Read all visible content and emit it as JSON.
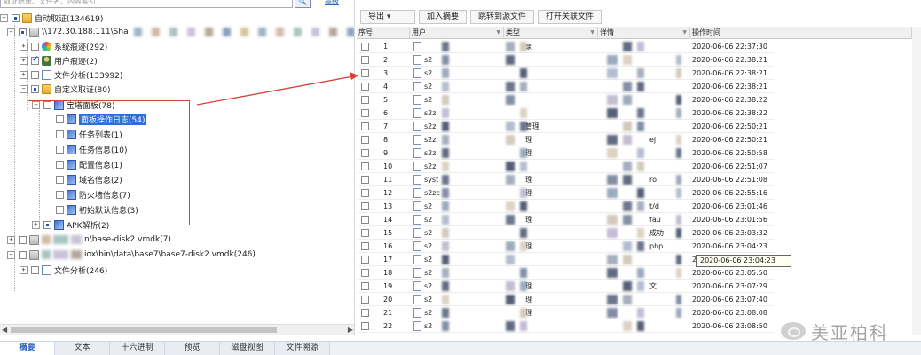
{
  "search": {
    "placeholder": "取证结果、文件名、内容索引",
    "button": "🔍",
    "advanced": "高级"
  },
  "tree": [
    {
      "id": "root",
      "expander": "−",
      "check": "partial",
      "icon": "folder",
      "label": "自动取证(134619)"
    },
    {
      "id": "share",
      "expander": "−",
      "check": "partial",
      "icon": "drive",
      "label": "\\\\172.30.188.111\\Sha",
      "blurred": true
    },
    {
      "id": "sys",
      "expander": "+",
      "check": "none",
      "icon": "colour",
      "label": "系统痕迹(292)"
    },
    {
      "id": "user",
      "expander": "+",
      "check": "checked",
      "icon": "user",
      "label": "用户痕迹(2)"
    },
    {
      "id": "fileana",
      "expander": "+",
      "check": "none",
      "icon": "doc",
      "label": "文件分析(133992)"
    },
    {
      "id": "custom",
      "expander": "−",
      "check": "partial",
      "icon": "folder",
      "label": "自定义取证(80)"
    },
    {
      "id": "baota",
      "expander": "−",
      "check": "none",
      "icon": "tool",
      "label": "宝塔面板(78)"
    },
    {
      "id": "panel-log",
      "expander": "",
      "check": "none",
      "icon": "tool",
      "label": "面板操作日志(54)",
      "selected": true
    },
    {
      "id": "task-list",
      "expander": "",
      "check": "none",
      "icon": "tool",
      "label": "任务列表(1)"
    },
    {
      "id": "task-info",
      "expander": "",
      "check": "none",
      "icon": "tool",
      "label": "任务信息(10)"
    },
    {
      "id": "config",
      "expander": "",
      "check": "none",
      "icon": "tool",
      "label": "配置信息(1)"
    },
    {
      "id": "domain",
      "expander": "",
      "check": "none",
      "icon": "tool",
      "label": "域名信息(2)"
    },
    {
      "id": "firewall",
      "expander": "",
      "check": "none",
      "icon": "tool",
      "label": "防火墙信息(7)"
    },
    {
      "id": "default",
      "expander": "",
      "check": "none",
      "icon": "tool",
      "label": "初始默认信息(3)"
    },
    {
      "id": "apk",
      "expander": "+",
      "check": "partial",
      "icon": "tool",
      "label": "APK解析(2)"
    },
    {
      "id": "disk2",
      "expander": "+",
      "check": "none",
      "icon": "drive",
      "label": "n\\base-disk2.vmdk(7)",
      "blurred": true
    },
    {
      "id": "disk7",
      "expander": "−",
      "check": "none",
      "icon": "drive",
      "label": "iox\\bin\\data\\base7\\base7-disk2.vmdk(246)",
      "blurred": true
    },
    {
      "id": "fileana2",
      "expander": "+",
      "check": "none",
      "icon": "doc",
      "label": "文件分析(246)"
    }
  ],
  "toolbar": {
    "export": "导出",
    "add_summary": "加入摘要",
    "jump_source": "跳转到源文件",
    "open_related": "打开关联文件"
  },
  "table": {
    "columns": [
      "序号",
      "用户",
      "类型",
      "详情",
      "操作时间"
    ],
    "rows": [
      {
        "no": "1",
        "user": "",
        "type": "录",
        "detail": "",
        "time": "2020-06-06 22:37:30"
      },
      {
        "no": "2",
        "user": "s2",
        "type": "",
        "detail": "",
        "time": "2020-06-06 22:38:21"
      },
      {
        "no": "3",
        "user": "s2",
        "type": "",
        "detail": "",
        "time": "2020-06-06 22:38:21"
      },
      {
        "no": "4",
        "user": "s2",
        "type": "",
        "detail": "",
        "time": "2020-06-06 22:38:21"
      },
      {
        "no": "5",
        "user": "s2",
        "type": "",
        "detail": "",
        "time": "2020-06-06 22:38:22"
      },
      {
        "no": "6",
        "user": "s2z",
        "type": "",
        "detail": "",
        "time": "2020-06-06 22:38:22"
      },
      {
        "no": "7",
        "user": "s2z",
        "type": "管理",
        "detail": "",
        "time": "2020-06-06 22:50:21"
      },
      {
        "no": "8",
        "user": "s2z",
        "type": "理",
        "detail": "ej",
        "time": "2020-06-06 22:50:21"
      },
      {
        "no": "9",
        "user": "s2z",
        "type": "理",
        "detail": "",
        "time": "2020-06-06 22:50:58"
      },
      {
        "no": "10",
        "user": "s2z",
        "type": "",
        "detail": "",
        "time": "2020-06-06 22:51:07"
      },
      {
        "no": "11",
        "user": "syst",
        "type": "理",
        "detail": "ro",
        "time": "2020-06-06 22:51:08"
      },
      {
        "no": "12",
        "user": "s2zc",
        "type": "理",
        "detail": "",
        "time": "2020-06-06 22:55:16"
      },
      {
        "no": "13",
        "user": "s2",
        "type": "",
        "detail": "t/d",
        "time": "2020-06-06 23:01:46"
      },
      {
        "no": "14",
        "user": "s2",
        "type": "理",
        "detail": "fau",
        "time": "2020-06-06 23:01:56"
      },
      {
        "no": "15",
        "user": "s2",
        "type": "",
        "detail": "成功",
        "time": "2020-06-06 23:03:32"
      },
      {
        "no": "16",
        "user": "s2",
        "type": "理",
        "detail": "php",
        "time": "2020-06-06 23:04:23"
      },
      {
        "no": "17",
        "user": "s2",
        "type": "",
        "detail": "",
        "time": "2020-06-06 23:04:23"
      },
      {
        "no": "18",
        "user": "s2",
        "type": "",
        "detail": "",
        "time": "2020-06-06 23:05:50"
      },
      {
        "no": "19",
        "user": "s2",
        "type": "理",
        "detail": "文",
        "time": "2020-06-06 23:07:29"
      },
      {
        "no": "20",
        "user": "s2",
        "type": "理",
        "detail": "",
        "time": "2020-06-06 23:07:40"
      },
      {
        "no": "21",
        "user": "s2",
        "type": "理",
        "detail": "",
        "time": "2020-06-06 23:08:08"
      },
      {
        "no": "22",
        "user": "s2",
        "type": "",
        "detail": "",
        "time": "2020-06-06 23:08:50"
      }
    ],
    "tooltip": "2020-06-06 23:04:23"
  },
  "bottom_tabs": [
    "摘要",
    "文本",
    "十六进制",
    "预览",
    "磁盘视图",
    "文件溯源"
  ],
  "watermark": "美亚柏科",
  "colors": {
    "accent": "#2a6fdb",
    "callout": "#d9403a"
  }
}
